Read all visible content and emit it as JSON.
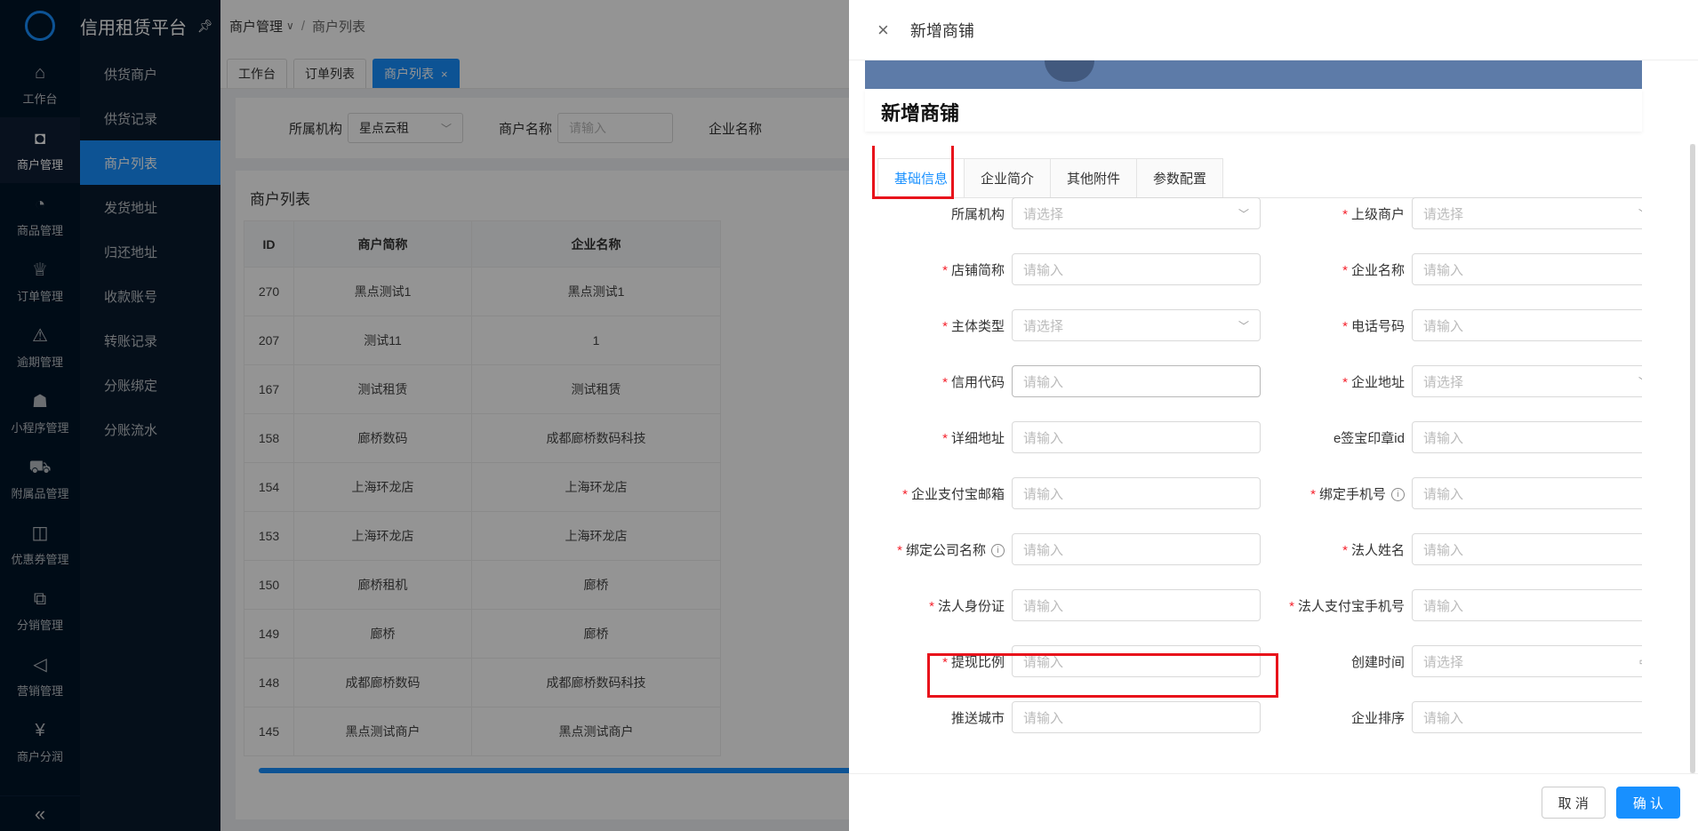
{
  "platform": {
    "title": "信用租赁平台"
  },
  "rail": [
    {
      "label": "工作台",
      "icon": "home-icon",
      "glyph": "⌂"
    },
    {
      "label": "商户管理",
      "icon": "shop-bag-icon",
      "glyph": "◘"
    },
    {
      "label": "商品管理",
      "icon": "apple-icon",
      "glyph": "◔"
    },
    {
      "label": "订单管理",
      "icon": "trophy-icon",
      "glyph": "♕"
    },
    {
      "label": "逾期管理",
      "icon": "alarm-icon",
      "glyph": "⚠"
    },
    {
      "label": "小程序管理",
      "icon": "android-icon",
      "glyph": "☗"
    },
    {
      "label": "附属品管理",
      "icon": "cart-icon",
      "glyph": "⛟"
    },
    {
      "label": "优惠券管理",
      "icon": "gift-icon",
      "glyph": "◫"
    },
    {
      "label": "分销管理",
      "icon": "sliders-icon",
      "glyph": "⧉"
    },
    {
      "label": "营销管理",
      "icon": "megaphone-icon",
      "glyph": "◁"
    },
    {
      "label": "商户分润",
      "icon": "yen-icon",
      "glyph": "¥"
    }
  ],
  "collapse_glyph": "«",
  "submenu": [
    "供货商户",
    "供货记录",
    "商户列表",
    "发货地址",
    "归还地址",
    "收款账号",
    "转账记录",
    "分账绑定",
    "分账流水"
  ],
  "breadcrumb": {
    "parent": "商户管理",
    "caret": "∨",
    "sep": "/",
    "current": "商户列表"
  },
  "tabs": [
    {
      "label": "工作台"
    },
    {
      "label": "订单列表"
    },
    {
      "label": "商户列表",
      "close": "×"
    }
  ],
  "filter": {
    "org_label": "所属机构",
    "org_value": "星点云租",
    "name_label": "商户名称",
    "name_placeholder": "请输入",
    "company_label": "企业名称"
  },
  "list": {
    "title": "商户列表",
    "columns": [
      "ID",
      "商户简称",
      "企业名称"
    ],
    "rows": [
      [
        "270",
        "黑点测试1",
        "黑点测试1"
      ],
      [
        "207",
        "测试11",
        "1"
      ],
      [
        "167",
        "测试租赁",
        "测试租赁"
      ],
      [
        "158",
        "廊桥数码",
        "成都廊桥数码科技"
      ],
      [
        "154",
        "上海环龙店",
        "上海环龙店"
      ],
      [
        "153",
        "上海环龙店",
        "上海环龙店"
      ],
      [
        "150",
        "廊桥租机",
        "廊桥"
      ],
      [
        "149",
        "廊桥",
        "廊桥"
      ],
      [
        "148",
        "成都廊桥数码",
        "成都廊桥数码科技"
      ],
      [
        "145",
        "黑点测试商户",
        "黑点测试商户"
      ]
    ]
  },
  "drawer": {
    "title": "新增商铺",
    "close": "×",
    "heading": "新增商铺",
    "form_tabs": [
      "基础信息",
      "企业简介",
      "其他附件",
      "参数配置"
    ],
    "fields": [
      {
        "label": "所属机构",
        "required": false,
        "placeholder": "请选择",
        "type": "select"
      },
      {
        "label": "上级商户",
        "required": true,
        "placeholder": "请选择",
        "type": "select"
      },
      {
        "label": "店铺简称",
        "required": true,
        "placeholder": "请输入",
        "type": "input"
      },
      {
        "label": "企业名称",
        "required": true,
        "placeholder": "请输入",
        "type": "input"
      },
      {
        "label": "主体类型",
        "required": true,
        "placeholder": "请选择",
        "type": "select"
      },
      {
        "label": "电话号码",
        "required": true,
        "placeholder": "请输入",
        "type": "input"
      },
      {
        "label": "信用代码",
        "required": true,
        "placeholder": "请输入",
        "type": "input"
      },
      {
        "label": "企业地址",
        "required": true,
        "placeholder": "请选择",
        "type": "select"
      },
      {
        "label": "详细地址",
        "required": true,
        "placeholder": "请输入",
        "type": "input"
      },
      {
        "label": "e签宝印章id",
        "required": false,
        "placeholder": "请输入",
        "type": "input"
      },
      {
        "label": "企业支付宝邮箱",
        "required": true,
        "placeholder": "请输入",
        "type": "input"
      },
      {
        "label": "绑定手机号",
        "required": true,
        "placeholder": "请输入",
        "type": "input",
        "info": true
      },
      {
        "label": "绑定公司名称",
        "required": true,
        "placeholder": "请输入",
        "type": "input",
        "info": true
      },
      {
        "label": "法人姓名",
        "required": true,
        "placeholder": "请输入",
        "type": "input"
      },
      {
        "label": "法人身份证",
        "required": true,
        "placeholder": "请输入",
        "type": "input"
      },
      {
        "label": "法人支付宝手机号",
        "required": true,
        "placeholder": "请输入",
        "type": "input"
      },
      {
        "label": "提现比例",
        "required": true,
        "placeholder": "请输入",
        "type": "input"
      },
      {
        "label": "创建时间",
        "required": false,
        "placeholder": "请选择",
        "type": "date"
      },
      {
        "label": "推送城市",
        "required": false,
        "placeholder": "请输入",
        "type": "input"
      },
      {
        "label": "企业排序",
        "required": false,
        "placeholder": "请输入",
        "type": "input"
      }
    ],
    "cancel": "取 消",
    "confirm": "确 认"
  },
  "colors": {
    "accent": "#1890ff",
    "sidebar": "#001529",
    "highlight": "#e8121b",
    "required": "#f5222d"
  }
}
